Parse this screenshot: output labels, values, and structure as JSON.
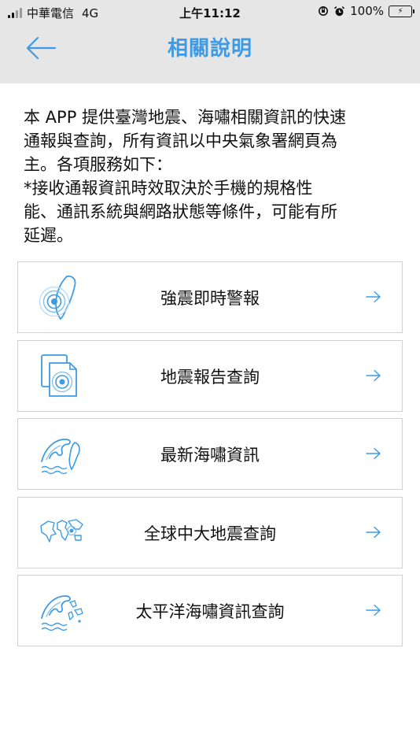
{
  "status_bar": {
    "carrier": "中華電信",
    "network": "4G",
    "time": "上午11:12",
    "battery": "100%",
    "battery_level": 1.0
  },
  "nav": {
    "title": "相關說明",
    "back_icon": "arrow-left-icon"
  },
  "intro": {
    "lines": [
      "本 APP 提供臺灣地震、海嘯相關資訊的快速",
      "通報與查詢，所有資訊以中央氣象署網頁為",
      "主。各項服務如下：",
      "*接收通報資訊時效取決於手機的規格性",
      "能、通訊系統與網路狀態等條件，可能有所",
      "延遲。"
    ]
  },
  "menu": {
    "items": [
      {
        "label": "強震即時警報",
        "icon": "taiwan-quake-alert-icon"
      },
      {
        "label": "地震報告查詢",
        "icon": "quake-report-document-icon"
      },
      {
        "label": "最新海嘯資訊",
        "icon": "tsunami-wave-icon"
      },
      {
        "label": "全球中大地震查詢",
        "icon": "world-map-icon"
      },
      {
        "label": "太平洋海嘯資訊查詢",
        "icon": "pacific-tsunami-icon"
      }
    ]
  },
  "colors": {
    "accent": "#3d9be3",
    "header_bg": "#e6e6e6",
    "border": "#d0d0d0"
  }
}
